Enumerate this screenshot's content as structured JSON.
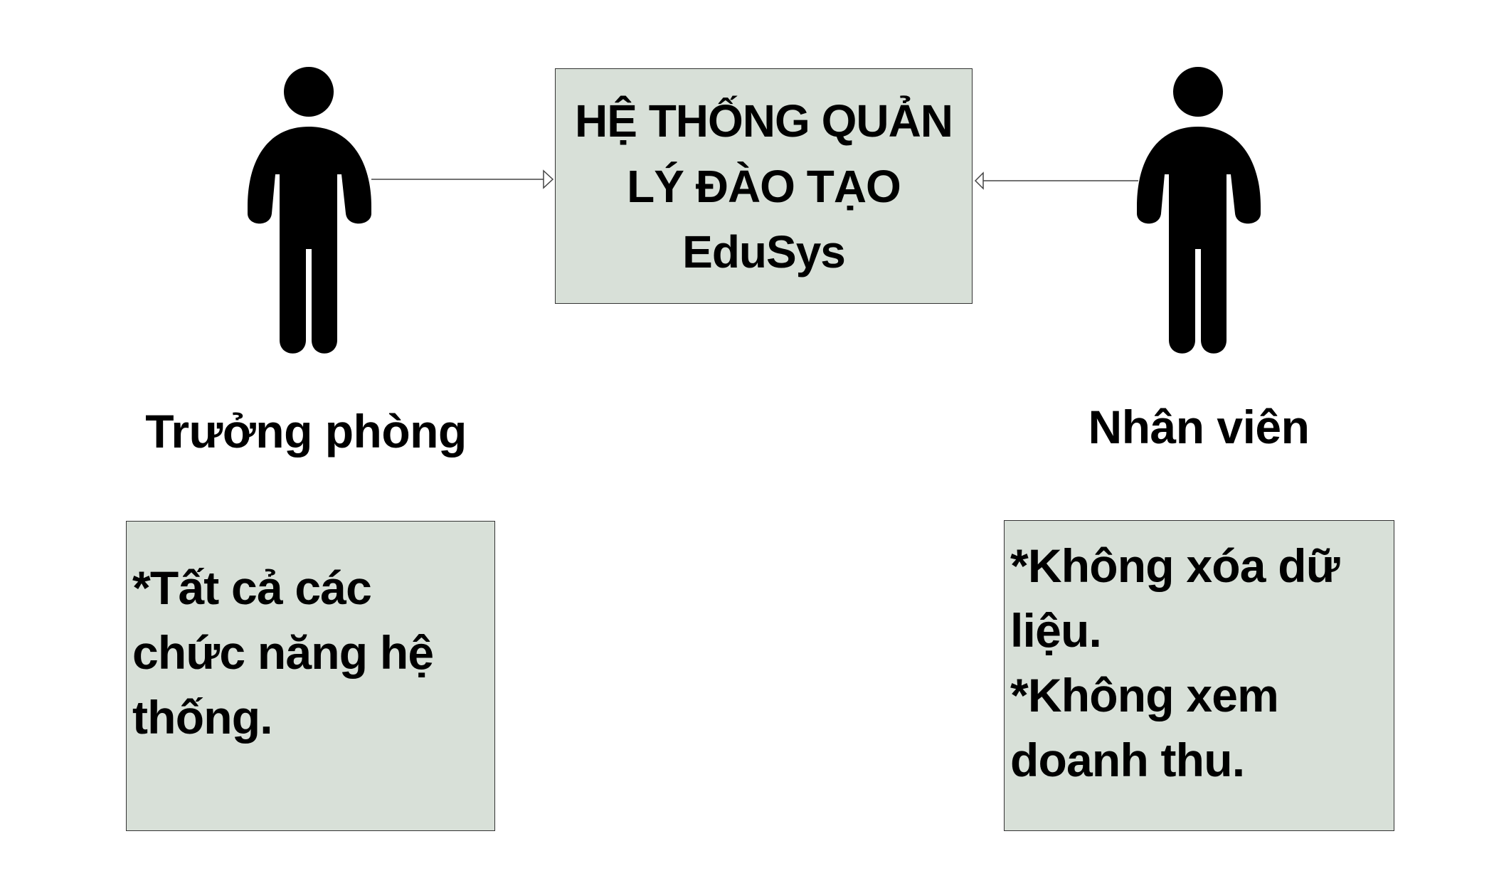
{
  "system": {
    "title_lines": [
      "HỆ THỐNG QUẢN",
      "LÝ ĐÀO TẠO",
      "EduSys"
    ]
  },
  "actors": {
    "left": {
      "label": "Trưởng phòng",
      "note_lines": [
        "*Tất cả các",
        "chức năng hệ",
        "thống."
      ]
    },
    "right": {
      "label": "Nhân viên",
      "note_lines": [
        "*Không xóa dữ",
        "liệu.",
        "*Không xem",
        "doanh thu."
      ]
    }
  },
  "colors": {
    "box_fill": "#d8e0d8",
    "figure": "#000000",
    "connector": "#444444"
  }
}
